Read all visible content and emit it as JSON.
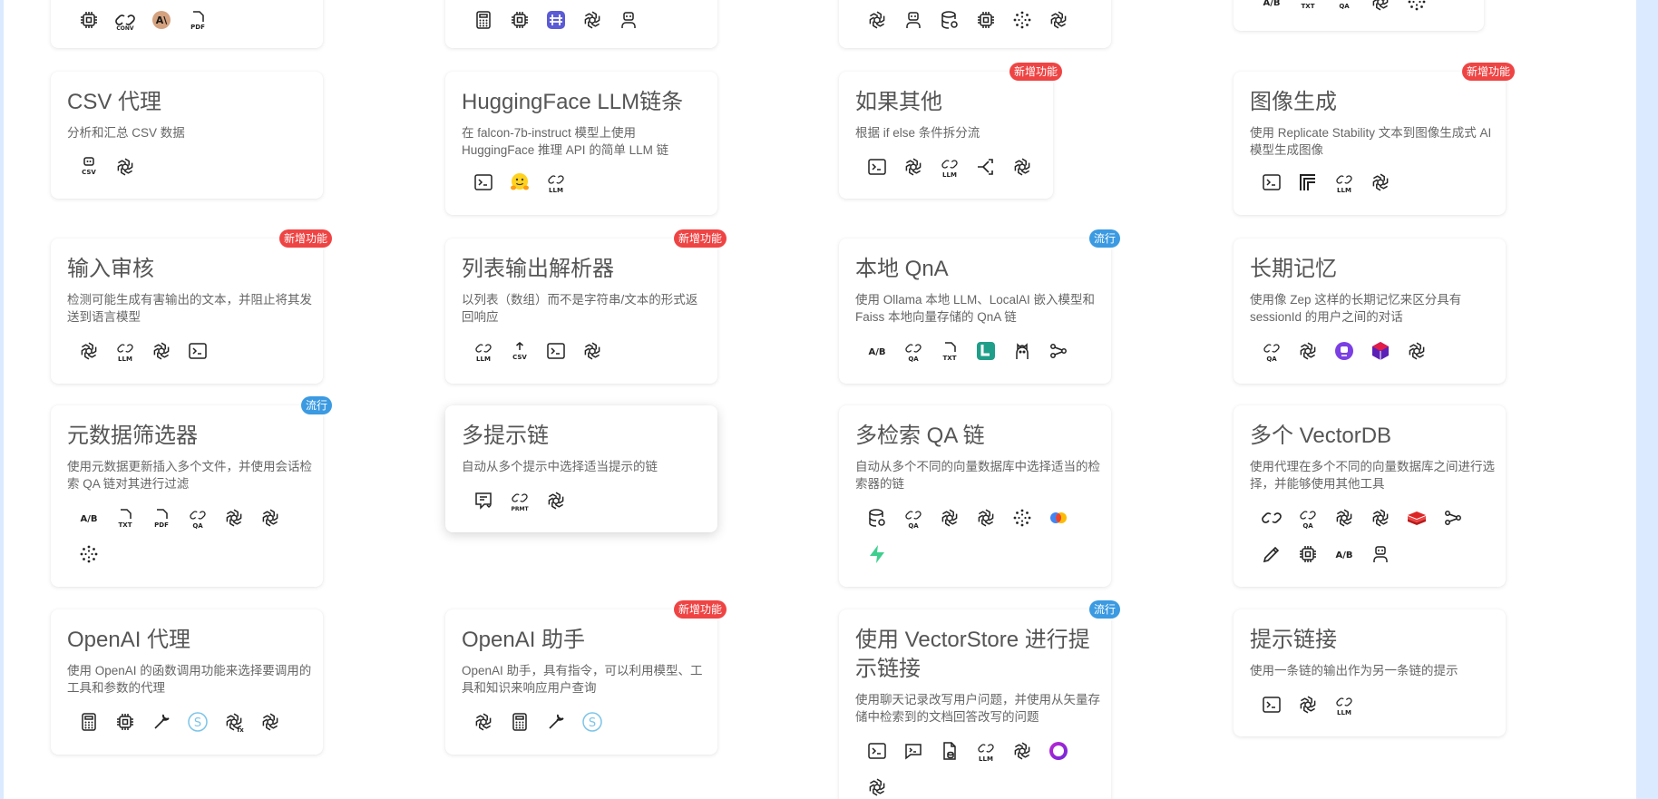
{
  "colors": {
    "new_badge": "#ef4444",
    "popular_badge": "#3b9ae1",
    "background": "#dbeafe"
  },
  "top_row": {
    "c1": [
      "cpu-icon",
      "conv-icon",
      "anthropic-icon",
      "pdf-icon"
    ],
    "c2": [
      "calculator-icon",
      "cpu-icon",
      "app-icon",
      "openai-icon",
      "bot-icon"
    ],
    "c3": [
      "openai-icon",
      "bot-icon",
      "database-icon",
      "cpu-icon",
      "flower-icon",
      "openai-icon"
    ],
    "c4": [
      "ab-icon",
      "txt-icon",
      "qa-icon",
      "openai-icon",
      "flower-icon"
    ]
  },
  "cards": {
    "csv_agent": {
      "title": "CSV 代理",
      "desc": "分析和汇总 CSV 数据"
    },
    "hf_llm": {
      "title": "HuggingFace LLM链条",
      "desc": "在 falcon-7b-instruct 模型上使用 HuggingFace 推理 API 的简单 LLM 链"
    },
    "if_else": {
      "title": "如果其他",
      "desc": "根据 if else 条件拆分流",
      "badge": "新增功能"
    },
    "image_gen": {
      "title": "图像生成",
      "desc": "使用 Replicate Stability 文本到图像生成式 AI 模型生成图像",
      "badge": "新增功能"
    },
    "moderation": {
      "title": "输入审核",
      "desc": "检测可能生成有害输出的文本，并阻止将其发送到语言模型",
      "badge": "新增功能"
    },
    "list_parser": {
      "title": "列表输出解析器",
      "desc": "以列表（数组）而不是字符串/文本的形式返回响应",
      "badge": "新增功能"
    },
    "local_qna": {
      "title": "本地 QnA",
      "desc": "使用 Ollama 本地 LLM、LocalAI 嵌入模型和 Faiss 本地向量存储的 QnA 链",
      "badge": "流行"
    },
    "long_memory": {
      "title": "长期记忆",
      "desc": "使用像 Zep 这样的长期记忆来区分具有 sessionId 的用户之间的对话"
    },
    "metadata_filter": {
      "title": "元数据筛选器",
      "desc": "使用元数据更新插入多个文件，并使用会话检索 QA 链对其进行过滤",
      "badge": "流行"
    },
    "multi_prompt": {
      "title": "多提示链",
      "desc": "自动从多个提示中选择适当提示的链"
    },
    "multi_retrieval": {
      "title": "多检索 QA 链",
      "desc": "自动从多个不同的向量数据库中选择适当的检索器的链"
    },
    "multi_vectordb": {
      "title": "多个 VectorDB",
      "desc": "使用代理在多个不同的向量数据库之间进行选择，并能够使用其他工具"
    },
    "openai_agent": {
      "title": "OpenAI 代理",
      "desc": "使用 OpenAI 的函数调用功能来选择要调用的工具和参数的代理"
    },
    "openai_assistant": {
      "title": "OpenAI 助手",
      "desc": "OpenAI 助手，具有指令，可以利用模型、工具和知识来响应用户查询",
      "badge": "新增功能"
    },
    "vectorstore_prompt": {
      "title": "使用 VectorStore 进行提示链接",
      "desc": "使用聊天记录改写用户问题，并使用从矢量存储中检索到的文档回答改写的问题",
      "badge": "流行"
    },
    "prompt_chain": {
      "title": "提示链接",
      "desc": "使用一条链的输出作为另一条链的提示"
    }
  }
}
